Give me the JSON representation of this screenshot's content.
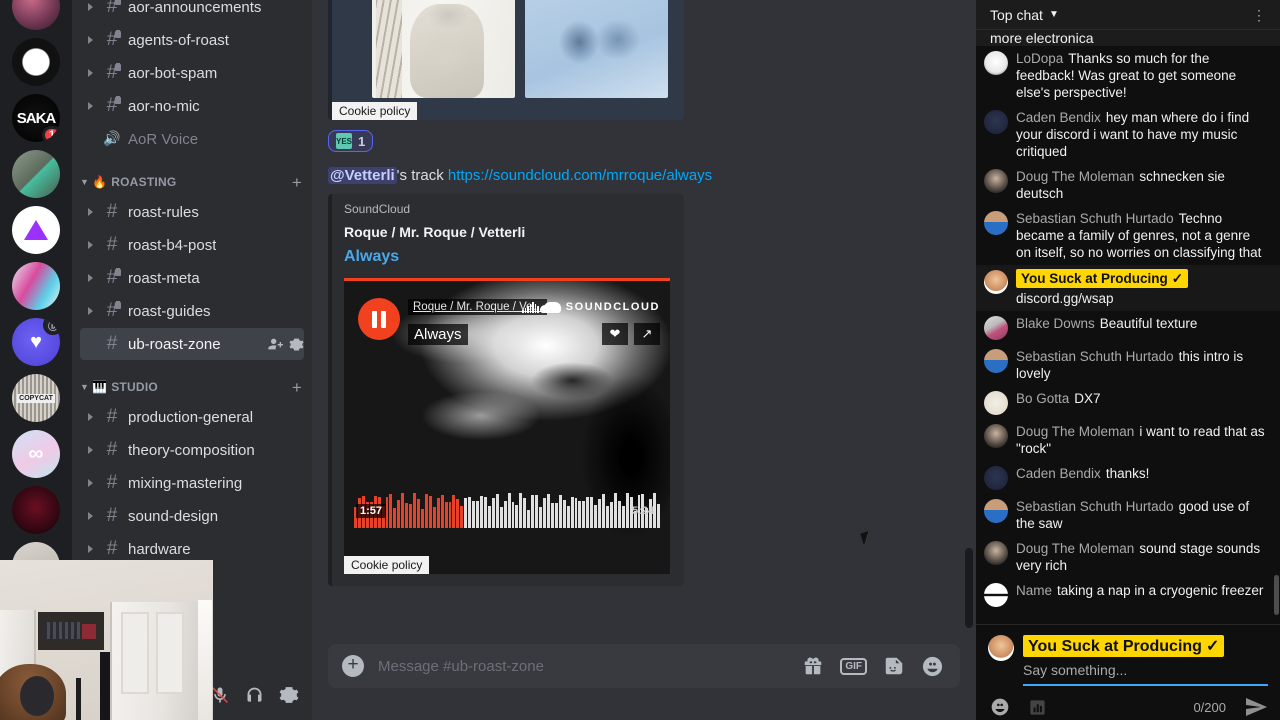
{
  "servers": [
    {
      "name": "server-flowers",
      "badge": null,
      "active": false
    },
    {
      "name": "server-enso",
      "badge": null,
      "active": true
    },
    {
      "name": "server-saka",
      "badge": "1",
      "active": false
    },
    {
      "name": "server-minecraft-ore",
      "badge": null,
      "active": false
    },
    {
      "name": "server-a-logo",
      "badge": null,
      "active": false
    },
    {
      "name": "server-colorful-swirl",
      "badge": null,
      "active": false
    },
    {
      "name": "server-blue-hands",
      "badge": null,
      "active": false,
      "sub": "ⓑ"
    },
    {
      "name": "server-copycat",
      "badge": null,
      "active": false
    },
    {
      "name": "server-infinity",
      "badge": null,
      "active": false
    },
    {
      "name": "server-red-sphere",
      "badge": null,
      "active": false
    },
    {
      "name": "server-partial",
      "badge": null,
      "active": false
    }
  ],
  "sidebar": {
    "groups": [
      {
        "id": "group-aor",
        "label": null,
        "emoji": null,
        "channels": [
          {
            "label": "aor-announcements",
            "type": "text",
            "locked": true,
            "arrow": true,
            "active": false
          },
          {
            "label": "agents-of-roast",
            "type": "text",
            "locked": true,
            "arrow": true,
            "active": false
          },
          {
            "label": "aor-bot-spam",
            "type": "text",
            "locked": true,
            "arrow": true,
            "active": false
          },
          {
            "label": "aor-no-mic",
            "type": "text",
            "locked": true,
            "arrow": true,
            "active": false
          },
          {
            "label": "AoR Voice",
            "type": "voice",
            "locked": false,
            "arrow": false,
            "active": false
          }
        ]
      },
      {
        "id": "group-roasting",
        "label": "ROASTING",
        "emoji": "🔥",
        "channels": [
          {
            "label": "roast-rules",
            "type": "text",
            "locked": false,
            "arrow": true,
            "active": false
          },
          {
            "label": "roast-b4-post",
            "type": "text",
            "locked": false,
            "arrow": true,
            "active": false
          },
          {
            "label": "roast-meta",
            "type": "text",
            "locked": true,
            "arrow": true,
            "active": false
          },
          {
            "label": "roast-guides",
            "type": "text",
            "locked": true,
            "arrow": true,
            "active": false
          },
          {
            "label": "ub-roast-zone",
            "type": "text",
            "locked": false,
            "arrow": false,
            "active": true
          }
        ]
      },
      {
        "id": "group-studio",
        "label": "STUDIO",
        "emoji": "🎹",
        "channels": [
          {
            "label": "production-general",
            "type": "text",
            "locked": false,
            "arrow": true,
            "active": false
          },
          {
            "label": "theory-composition",
            "type": "text",
            "locked": false,
            "arrow": true,
            "active": false
          },
          {
            "label": "mixing-mastering",
            "type": "text",
            "locked": false,
            "arrow": true,
            "active": false
          },
          {
            "label": "sound-design",
            "type": "text",
            "locked": false,
            "arrow": true,
            "active": false
          },
          {
            "label": "hardware",
            "type": "text",
            "locked": false,
            "arrow": true,
            "active": false
          }
        ]
      }
    ],
    "add_tooltip": "+",
    "invite_icon": "invite-member-icon",
    "settings_icon": "channel-settings-icon"
  },
  "message": {
    "mention": "@Vetterli",
    "text_after_mention": "'s track ",
    "link": "https://soundcloud.com/mrroque/always",
    "reaction": {
      "emoji_label": "YES",
      "count": "1"
    },
    "cookie_policy": "Cookie policy"
  },
  "embed": {
    "provider": "SoundCloud",
    "author": "Roque / Mr. Roque / Vetterli",
    "title": "Always",
    "player": {
      "artist_label": "Roque / Mr. Roque / Ve...",
      "track_label": "Always",
      "brand": "SOUNDCLOUD",
      "current_time": "1:57",
      "duration": "5:24",
      "play_state": "pause",
      "like_icon": "heart-icon",
      "share_icon": "share-icon",
      "progress_percent": 36,
      "accent_color": "#f1411e"
    }
  },
  "composer": {
    "placeholder": "Message #ub-roast-zone",
    "plus_icon": "add-attachment-icon",
    "gift_icon": "gift-icon",
    "gif_label": "GIF",
    "sticker_icon": "sticker-icon",
    "emoji_icon": "emoji-icon"
  },
  "voice_controls": {
    "mute_icon": "microphone-muted-icon",
    "deafen_icon": "headphones-icon",
    "settings_icon": "user-settings-icon"
  },
  "youtube_chat": {
    "header_title": "Top chat",
    "header_chevron": "chevron-down-icon",
    "kebab_icon": "more-options-icon",
    "cut_text": "more electronica",
    "messages": [
      {
        "author": "LoDopa",
        "text": "Thanks so much for the feedback! Was great to get someone else's perspective!",
        "owner": false,
        "highlight": false,
        "avatar": "avatar-lodopa"
      },
      {
        "author": "Caden Bendix",
        "text": "hey man where do i find your discord i want to have my music critiqued",
        "owner": false,
        "highlight": false,
        "avatar": "avatar-caden"
      },
      {
        "author": "Doug The Moleman",
        "text": "schnecken sie deutsch",
        "owner": false,
        "highlight": false,
        "avatar": "avatar-doug"
      },
      {
        "author": "Sebastian Schuth Hurtado",
        "text": "Techno became a family of genres, not a genre on itself, so no worries on classifying that",
        "owner": false,
        "highlight": false,
        "avatar": "avatar-sebastian"
      },
      {
        "author": "You Suck at Producing",
        "text": "discord.gg/wsap",
        "owner": true,
        "highlight": true,
        "avatar": "avatar-owner"
      },
      {
        "author": "Blake Downs",
        "text": "Beautiful texture",
        "owner": false,
        "highlight": false,
        "avatar": "avatar-blake"
      },
      {
        "author": "Sebastian Schuth Hurtado",
        "text": "this intro is lovely",
        "owner": false,
        "highlight": false,
        "avatar": "avatar-sebastian"
      },
      {
        "author": "Bo Gotta",
        "text": "DX7",
        "owner": false,
        "highlight": false,
        "avatar": "avatar-bo"
      },
      {
        "author": "Doug The Moleman",
        "text": "i want to read that as \"rock\"",
        "owner": false,
        "highlight": false,
        "avatar": "avatar-doug"
      },
      {
        "author": "Caden Bendix",
        "text": "thanks!",
        "owner": false,
        "highlight": false,
        "avatar": "avatar-caden"
      },
      {
        "author": "Sebastian Schuth Hurtado",
        "text": "good use of the saw",
        "owner": false,
        "highlight": false,
        "avatar": "avatar-sebastian"
      },
      {
        "author": "Doug The Moleman",
        "text": "sound stage sounds very rich",
        "owner": false,
        "highlight": false,
        "avatar": "avatar-doug"
      },
      {
        "author": "Name",
        "text": "taking a nap in a cryogenic freezer",
        "owner": false,
        "highlight": false,
        "avatar": "avatar-name"
      }
    ],
    "input": {
      "owner_badge": "You Suck at Producing",
      "verified_icon": "verified-check-icon",
      "placeholder": "Say something...",
      "emoji_icon": "emoji-icon",
      "poll_icon": "poll-icon",
      "char_count": "0/200",
      "send_icon": "send-icon",
      "accent_color": "#3ea6ff",
      "owner_badge_color": "#ffd600"
    }
  }
}
